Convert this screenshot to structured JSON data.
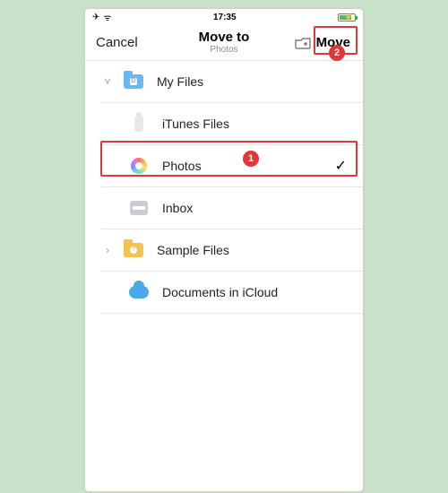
{
  "status": {
    "time": "17:35",
    "airplane": "✈",
    "wifi": "ᯤ"
  },
  "nav": {
    "cancel": "Cancel",
    "title": "Move to",
    "subtitle": "Photos",
    "move": "Move"
  },
  "badges": {
    "one": "1",
    "two": "2"
  },
  "rows": {
    "myfiles": {
      "label": "My Files",
      "folder_letter": "D"
    },
    "itunes": {
      "label": "iTunes Files"
    },
    "photos": {
      "label": "Photos"
    },
    "inbox": {
      "label": "Inbox"
    },
    "sample": {
      "label": "Sample Files",
      "folder_letter": "?"
    },
    "icloud": {
      "label": "Documents in iCloud"
    }
  },
  "checkmark": "✓"
}
